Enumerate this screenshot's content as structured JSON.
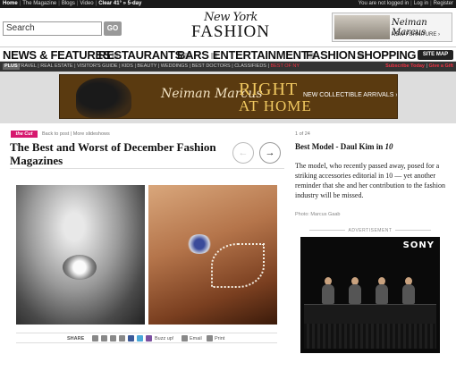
{
  "topbar": {
    "home": "Home",
    "magazine": "The Magazine",
    "blogs": "Blogs",
    "video": "Video",
    "weather": "Clear 41° » 5-day",
    "login_status": "You are not logged in",
    "login": "Log in",
    "register": "Register"
  },
  "header": {
    "search_value": "Search",
    "go_label": "GO",
    "logo_top": "New York",
    "logo_bottom": "FASHION",
    "ad": {
      "brand": "Neiman Marcus",
      "tagline": "NEW FURNITURE ›"
    }
  },
  "nav": {
    "items": [
      "NEWS & FEATURES",
      "RESTAURANTS",
      "BARS",
      "ENTERTAINMENT",
      "FASHION",
      "SHOPPING"
    ],
    "sitemap": "SITE MAP"
  },
  "subnav": {
    "plus": "PLUS",
    "links": "TRAVEL | REAL ESTATE | VISITOR'S GUIDE | KIDS | BEAUTY | WEDDINGS | BEST DOCTORS | CLASSIFIEDS |",
    "best": "BEST OF NY",
    "subscribe": "Subscribe Today",
    "gift": "Give a Gift"
  },
  "banner": {
    "brand": "Neiman Marcus",
    "headline1": "RIGHT",
    "headline2": "AT HOME",
    "cta": "NEW COLLECTIBLE ARRIVALS ›"
  },
  "article": {
    "badge": "the Cut",
    "back": "Back to post",
    "more": "More slideshows",
    "title": "The Best and Worst of December Fashion Magazines",
    "share_label": "SHARE",
    "buzz": "Buzz up!",
    "email": "Email",
    "print": "Print"
  },
  "slide": {
    "counter": "1 of 24",
    "title_pre": "Best Model - Daul Kim in",
    "title_mag": "10",
    "description": "The model, who recently passed away, posed for a striking accessories editorial in 10 — yet another reminder that she and her contribution to the fashion industry will be missed.",
    "credit": "Photo: Marcus Gaab"
  },
  "ad": {
    "label": "ADVERTISEMENT",
    "brand": "SONY"
  }
}
